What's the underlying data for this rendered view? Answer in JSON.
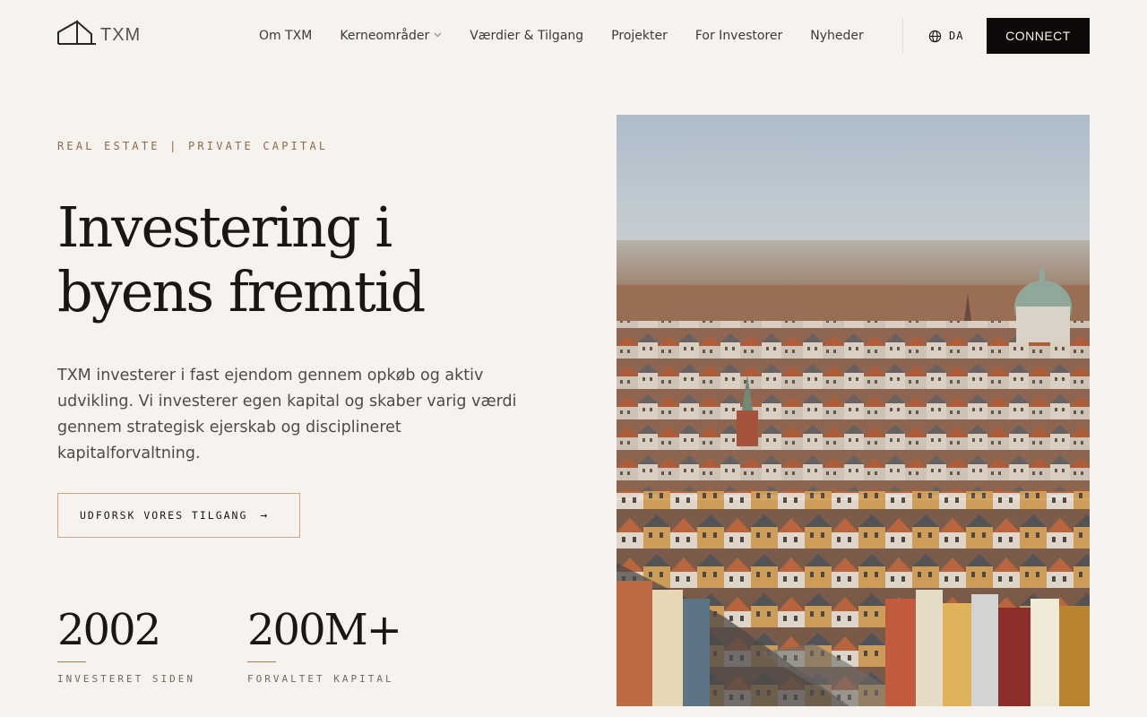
{
  "header": {
    "logo_text": "TXM",
    "nav": [
      {
        "label": "Om TXM"
      },
      {
        "label": "Kerneområder",
        "has_dropdown": true
      },
      {
        "label": "Værdier & Tilgang"
      },
      {
        "label": "Projekter"
      },
      {
        "label": "For Investorer"
      },
      {
        "label": "Nyheder"
      }
    ],
    "language": "DA",
    "connect_label": "CONNECT"
  },
  "hero": {
    "eyebrow": "REAL ESTATE | PRIVATE CAPITAL",
    "headline_line1": "Investering i",
    "headline_line2": "byens fremtid",
    "lead": "TXM investerer i fast ejendom gennem opkøb og aktiv udvikling. Vi investerer egen kapital og skaber varig værdi gennem strategisk ejerskab og disciplineret kapitalforvaltning.",
    "cta_label": "UDFORSK VORES TILGANG",
    "cta_arrow": "→",
    "stats": [
      {
        "value": "2002",
        "label": "INVESTERET SIDEN"
      },
      {
        "value": "200M+",
        "label": "FORVALTET KAPITAL"
      }
    ]
  },
  "colors": {
    "background": "#f6f3ef",
    "accent": "#8a6a48",
    "button_dark": "#0c0908",
    "cta_border": "#c8a98a"
  },
  "icons": {
    "logo": "house-outline-logo",
    "language": "globe-icon",
    "dropdown": "chevron-down-icon",
    "cta": "arrow-right-icon"
  }
}
